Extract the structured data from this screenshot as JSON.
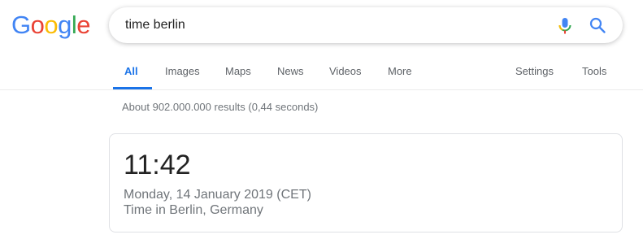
{
  "logo": {
    "letters": [
      "G",
      "o",
      "o",
      "g",
      "l",
      "e"
    ],
    "colors": [
      "#4285F4",
      "#EA4335",
      "#FBBC05",
      "#4285F4",
      "#34A853",
      "#EA4335"
    ]
  },
  "search": {
    "value": "time berlin",
    "mic_icon": "microphone-icon",
    "search_icon": "magnifier-icon",
    "accent": "#4285F4"
  },
  "tabs": {
    "all": "All",
    "images": "Images",
    "maps": "Maps",
    "news": "News",
    "videos": "Videos",
    "more": "More",
    "settings": "Settings",
    "tools": "Tools",
    "active": "All",
    "active_color": "#1a73e8"
  },
  "results": {
    "stats": "About 902.000.000 results (0,44 seconds)"
  },
  "time_card": {
    "time": "11:42",
    "date": "Monday, 14 January 2019 (CET)",
    "place": "Time in Berlin, Germany"
  }
}
